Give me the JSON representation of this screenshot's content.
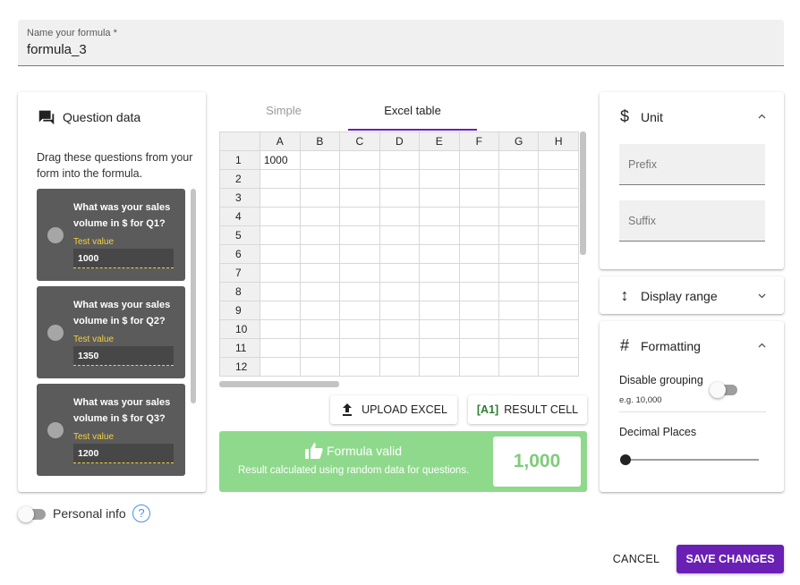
{
  "name_field": {
    "label": "Name your formula *",
    "value": "formula_3"
  },
  "question_data": {
    "title": "Question data",
    "help_text": "Drag these questions from your form into the formula.",
    "questions": [
      {
        "text": "What was your sales volume in $ for Q1?",
        "test_label": "Test value",
        "test_value": "1000"
      },
      {
        "text": "What was your sales volume in $ for Q2?",
        "test_label": "Test value",
        "test_value": "1350"
      },
      {
        "text": "What was your sales volume in $ for Q3?",
        "test_label": "Test value",
        "test_value": "1200"
      }
    ]
  },
  "tabs": {
    "simple": "Simple",
    "excel": "Excel table"
  },
  "sheet": {
    "columns": [
      "A",
      "B",
      "C",
      "D",
      "E",
      "F",
      "G",
      "H"
    ],
    "rows": [
      "1",
      "2",
      "3",
      "4",
      "5",
      "6",
      "7",
      "8",
      "9",
      "10",
      "11",
      "12"
    ],
    "cells": {
      "A1": "1000"
    }
  },
  "buttons": {
    "upload": "UPLOAD EXCEL",
    "result_prefix": "[A1]",
    "result": "RESULT CELL",
    "cancel": "CANCEL",
    "save": "SAVE CHANGES"
  },
  "validation": {
    "title": "Formula valid",
    "subtitle": "Result calculated using random data for questions.",
    "value": "1,000",
    "color": "#8fd98c"
  },
  "unit": {
    "title": "Unit",
    "icon": "$",
    "prefix_placeholder": "Prefix",
    "suffix_placeholder": "Suffix"
  },
  "display_range": {
    "title": "Display range",
    "icon": "↕"
  },
  "formatting": {
    "title": "Formatting",
    "icon": "#",
    "disable_grouping_label": "Disable grouping",
    "disable_grouping_example": "e.g. 10,000",
    "disable_grouping_on": false,
    "decimal_places_label": "Decimal Places",
    "decimal_places_value": 0
  },
  "personal_info": {
    "label": "Personal info",
    "help_icon": "?",
    "enabled": false
  },
  "colors": {
    "accent": "#6a1fb5",
    "valid_green": "#8fd98c",
    "test_value_yellow": "#f4d03f"
  }
}
